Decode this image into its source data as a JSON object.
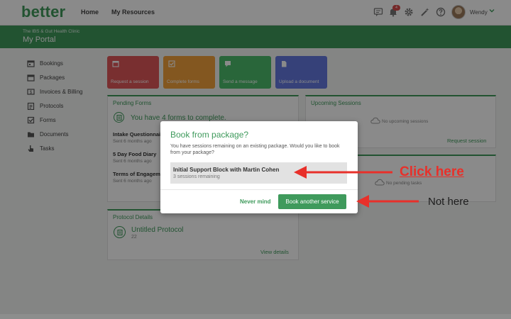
{
  "app": {
    "logo": "better"
  },
  "nav": {
    "home": "Home",
    "resources": "My Resources"
  },
  "topbar": {
    "icons": [
      "chat-icon",
      "bell-icon",
      "gear-icon",
      "magic-wand-icon",
      "help-icon"
    ],
    "notification_count": "4",
    "user_name": "Wendy"
  },
  "header": {
    "clinic": "The IBS & Gut Health Clinic",
    "title": "My Portal"
  },
  "sidebar": {
    "items": [
      {
        "label": "Bookings",
        "icon": "calendar-icon"
      },
      {
        "label": "Packages",
        "icon": "package-icon"
      },
      {
        "label": "Invoices & Billing",
        "icon": "dollar-icon"
      },
      {
        "label": "Protocols",
        "icon": "clipboard-icon"
      },
      {
        "label": "Forms",
        "icon": "checkbox-icon"
      },
      {
        "label": "Documents",
        "icon": "folder-icon"
      },
      {
        "label": "Tasks",
        "icon": "hand-pointer-icon"
      }
    ]
  },
  "tiles": [
    {
      "label": "Request a session",
      "color": "#e0585a"
    },
    {
      "label": "Complete forms",
      "color": "#f3a13b"
    },
    {
      "label": "Send a message",
      "color": "#4cbd6b"
    },
    {
      "label": "Upload a document",
      "color": "#6478e0"
    }
  ],
  "pending_forms": {
    "title": "Pending Forms",
    "banner": "You have 4 forms to complete.",
    "forms": [
      {
        "name": "Intake Questionnaire",
        "sub": "Sent 6 months ago"
      },
      {
        "name": "5 Day Food Diary",
        "sub": "Sent 6 months ago"
      },
      {
        "name": "Terms of Engagement",
        "sub": "Sent 6 months ago"
      }
    ]
  },
  "upcoming": {
    "title": "Upcoming Sessions",
    "empty": "No upcoming sessions",
    "action": "Request session"
  },
  "pending_tasks": {
    "empty": "No pending tasks"
  },
  "protocol": {
    "title": "Protocol Details",
    "name": "Untitled Protocol",
    "sub": "22",
    "action": "View details"
  },
  "modal": {
    "title": "Book from package?",
    "description": "You have sessions remaining on an existing package. Would you like to book from your package?",
    "package_name": "Initial Support Block with Martin Cohen",
    "package_sub": "3 sessions remaining",
    "never_mind": "Never mind",
    "book_other": "Book another service"
  },
  "annotations": {
    "click_here": "Click here",
    "not_here": "Not here",
    "arrow_color": "#e8302a"
  },
  "colors": {
    "brand": "#3f9a5c"
  }
}
